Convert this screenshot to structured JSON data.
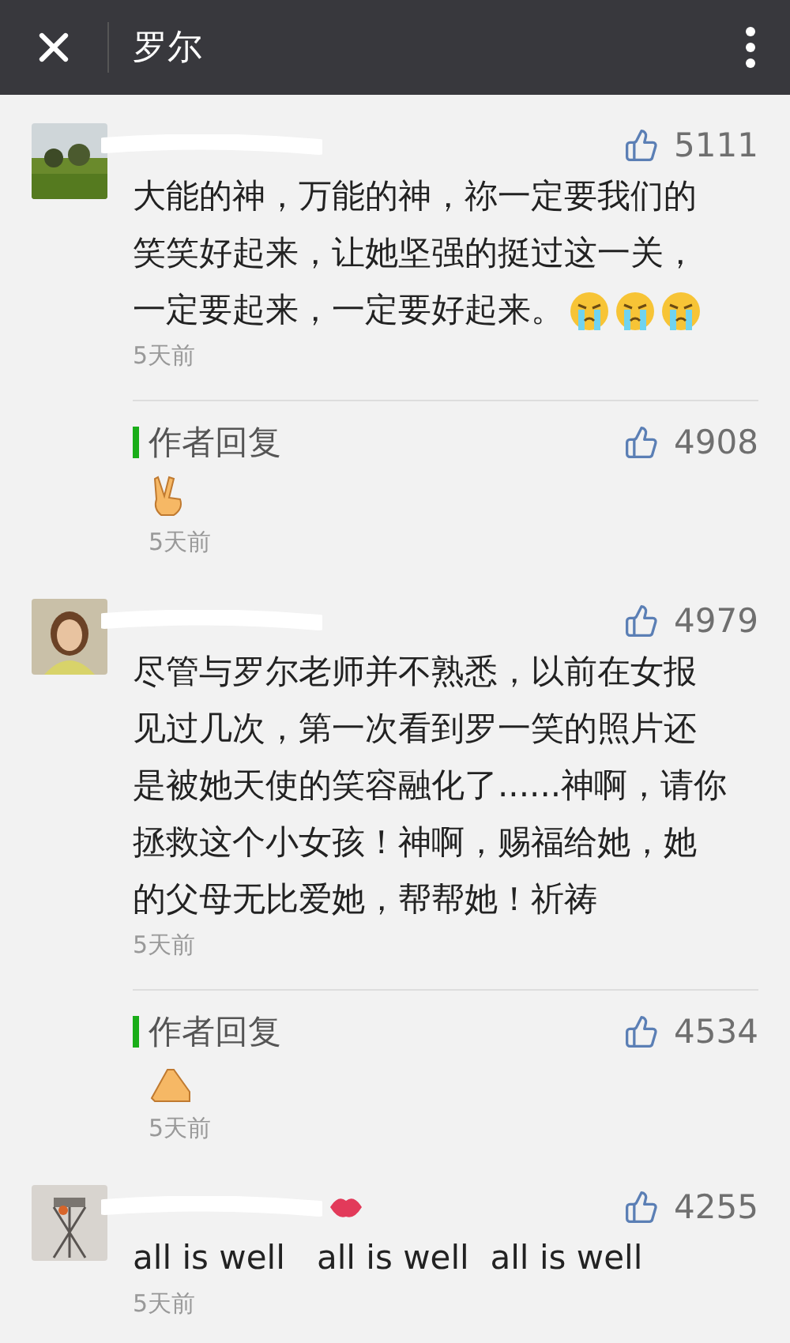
{
  "header": {
    "title": "罗尔"
  },
  "comments": [
    {
      "likes": "5111",
      "text": "大能的神，万能的神，祢一定要我们的笑笑好起来，让她坚强的挺过这一关，一定要起来，一定要好起来。",
      "emoji": [
        {
          "kind": "crying"
        },
        {
          "kind": "crying"
        },
        {
          "kind": "crying"
        }
      ],
      "time": "5天前",
      "reply": {
        "label": "作者回复",
        "likes": "4908",
        "emoji": [
          {
            "kind": "victory"
          }
        ],
        "time": "5天前"
      }
    },
    {
      "likes": "4979",
      "text": "尽管与罗尔老师并不熟悉，以前在女报见过几次，第一次看到罗一笑的照片还是被她天使的笑容融化了......神啊，请你拯救这个小女孩！神啊，赐福给她，她的父母无比爱她，帮帮她！祈祷",
      "time": "5天前",
      "reply": {
        "label": "作者回复",
        "likes": "4534",
        "emoji": [
          {
            "kind": "praying"
          }
        ],
        "time": "5天前"
      }
    },
    {
      "name_emoji": [
        {
          "kind": "lips"
        }
      ],
      "likes": "4255",
      "text": "all is well   all is well  all is well",
      "time": "5天前"
    }
  ]
}
